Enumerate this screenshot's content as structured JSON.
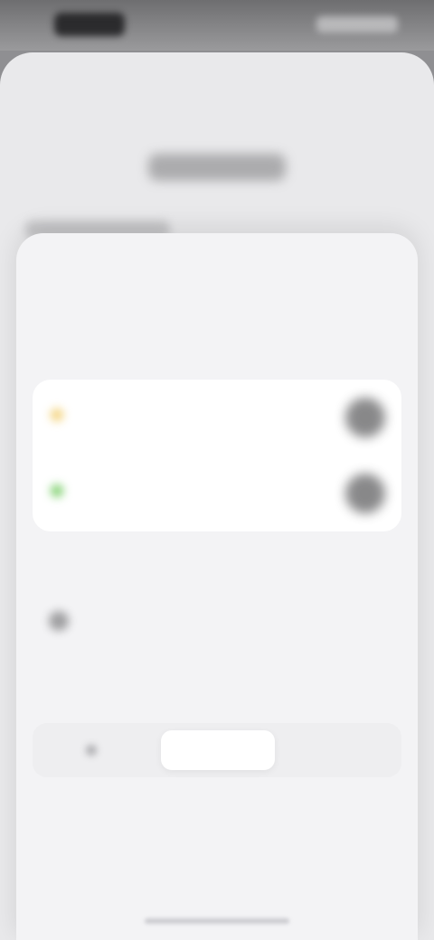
{
  "status_bar": {
    "time": "",
    "icons": [
      "signal-icon",
      "wifi-icon",
      "battery-icon"
    ]
  },
  "background_sheet": {
    "title": "",
    "row_label": ""
  },
  "sheet": {
    "title": "",
    "section_1": {
      "header": "",
      "rows": [
        {
          "title": "",
          "subtitle": "",
          "icon": "status-dot-icon",
          "icon_color": "#f3d27a"
        },
        {
          "title": "",
          "subtitle": "",
          "icon": "status-dot-icon",
          "icon_color": "#7fd06e"
        }
      ]
    },
    "section_2": {
      "header": "",
      "row": {
        "title": "",
        "subtitle": "",
        "icon": "info-icon"
      }
    },
    "section_3": {
      "header": "",
      "segments": [
        {
          "label": ""
        },
        {
          "label": ""
        },
        {
          "label": ""
        }
      ]
    }
  },
  "colors": {
    "sheet_bg": "#f3f3f5",
    "card_bg": "#ffffff",
    "text_primary": "#1c1c1e",
    "text_secondary": "#8e8e93"
  }
}
